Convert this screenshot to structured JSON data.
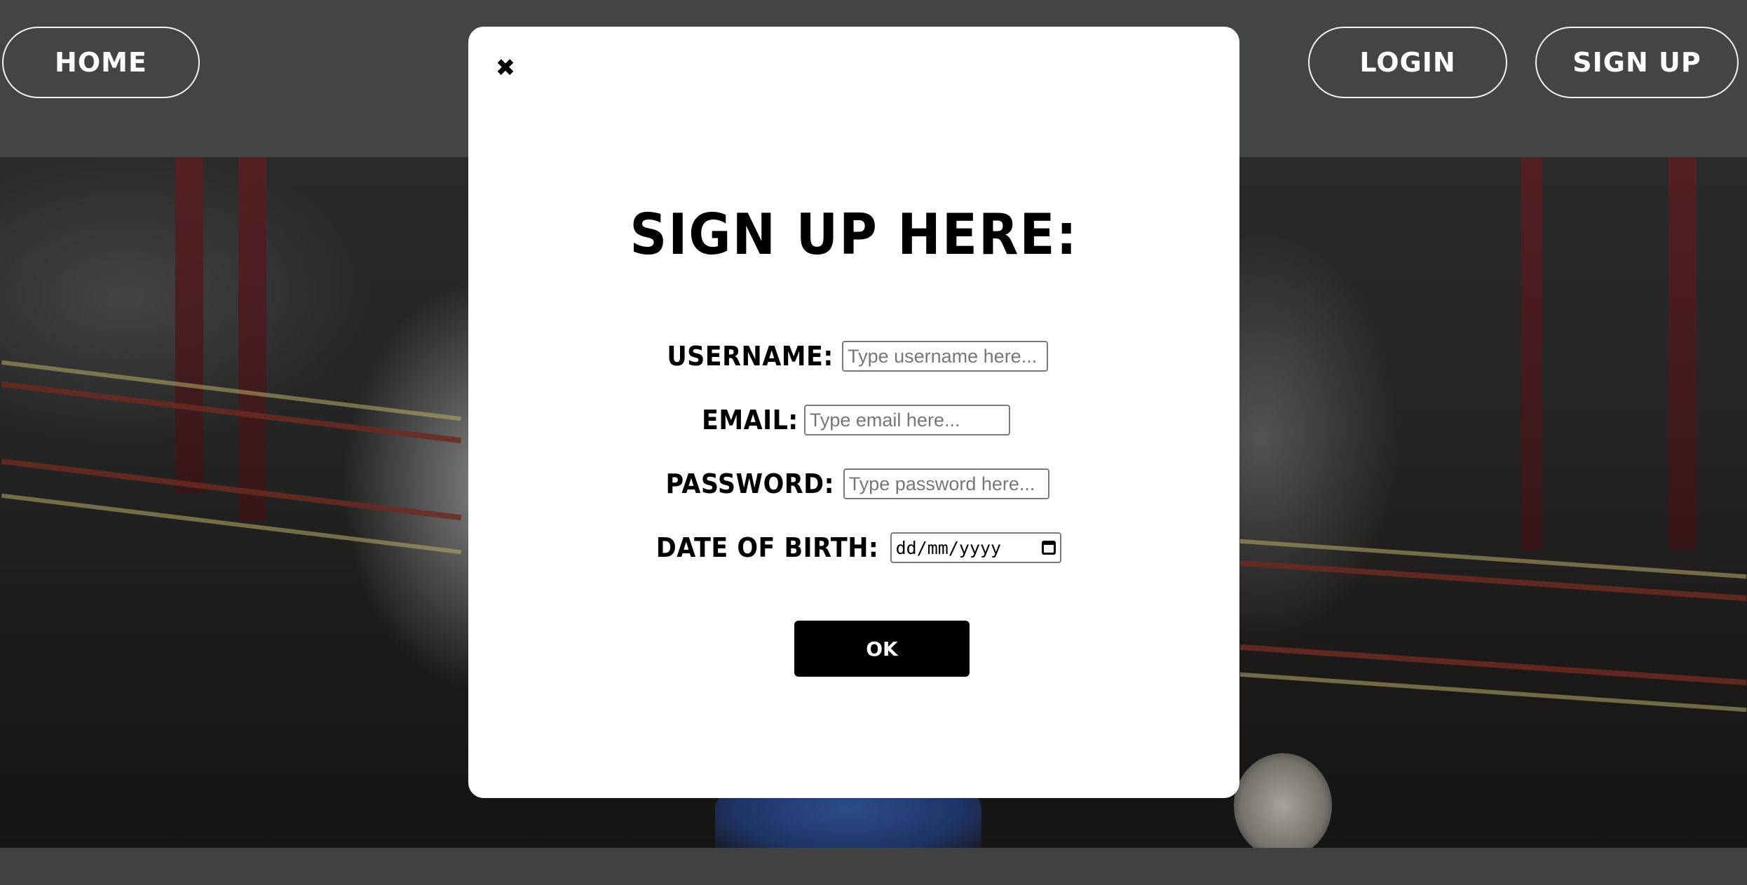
{
  "nav": {
    "home_label": "HOME",
    "login_label": "LOGIN",
    "signup_label": "SIGN UP"
  },
  "modal": {
    "close_glyph": "✖",
    "title": "SIGN UP HERE:",
    "fields": {
      "username": {
        "label": "USERNAME:",
        "placeholder": "Type username here..."
      },
      "email": {
        "label": "EMAIL:",
        "placeholder": "Type email here..."
      },
      "password": {
        "label": "PASSWORD:",
        "placeholder": "Type password here..."
      },
      "dob": {
        "label": "DATE OF BIRTH:",
        "placeholder": "dd/mm/yyyy"
      }
    },
    "ok_label": "OK"
  },
  "icons": {
    "close": "close-icon",
    "calendar": "calendar-icon"
  },
  "colors": {
    "header_bg": "#434545",
    "modal_bg": "#ffffff",
    "button_bg": "#000000",
    "nav_border": "#f2f2f2"
  }
}
